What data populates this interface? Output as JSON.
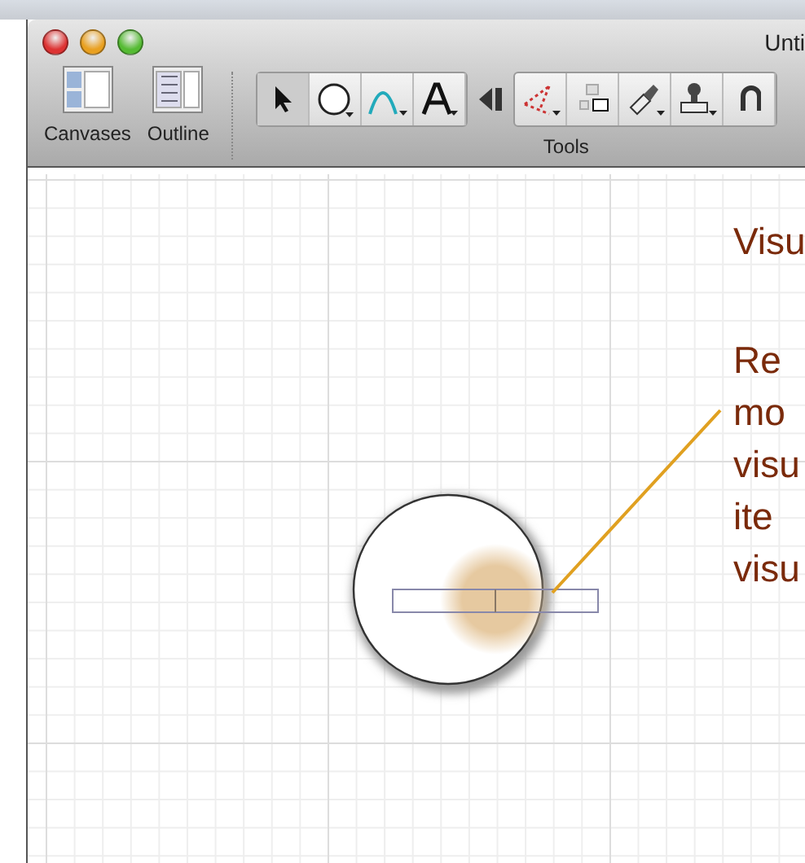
{
  "window": {
    "title": "Unti"
  },
  "toolbar": {
    "views": [
      {
        "label": "Canvases"
      },
      {
        "label": "Outline"
      }
    ],
    "tools_label": "Tools"
  },
  "canvas": {
    "heading": "Visu",
    "note_lines": [
      "Re",
      "mo",
      "visu",
      "ite",
      "visu"
    ]
  }
}
